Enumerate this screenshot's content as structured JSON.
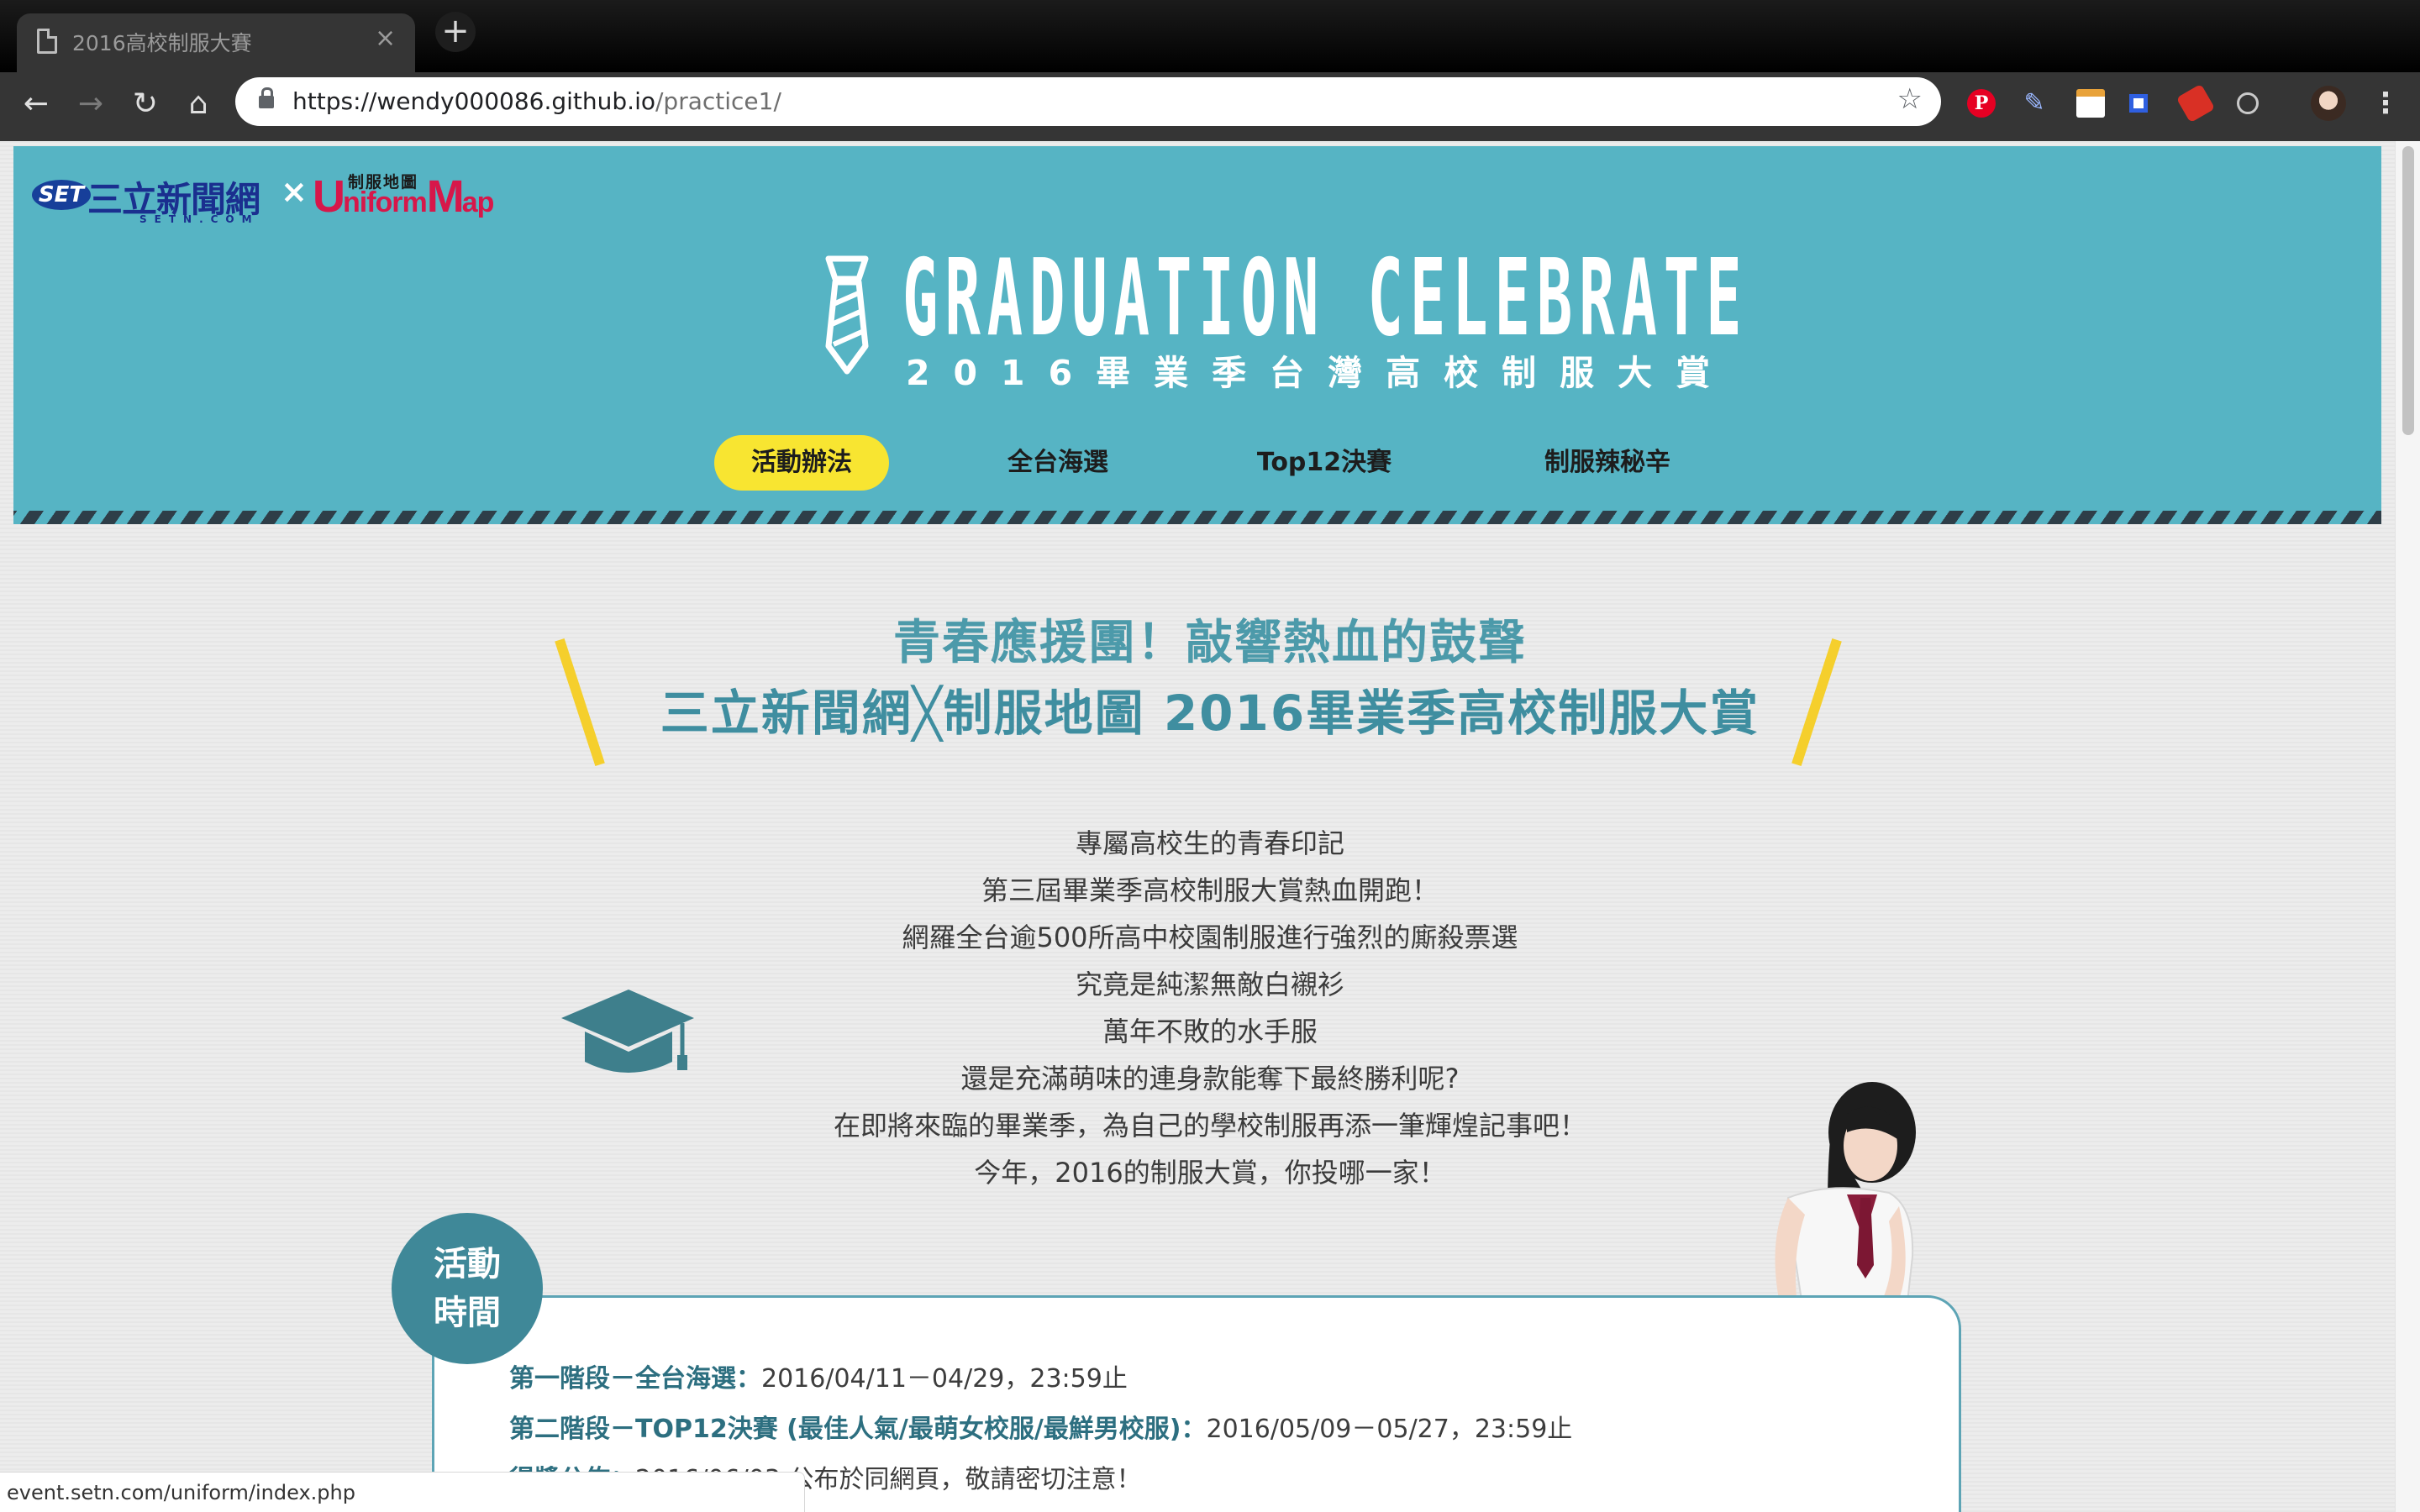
{
  "browser": {
    "tab_title": "2016高校制服大賽",
    "tab_close": "×",
    "new_tab": "+",
    "url_host": "https://wendy000086.github.io",
    "url_path": "/practice1/",
    "status_url": "event.setn.com/uniform/index.php",
    "buttons": {
      "back": "←",
      "forward": "→",
      "reload": "↻",
      "home": "⌂",
      "star": "☆",
      "menu": "⋮"
    },
    "extensions": [
      "pinterest-icon",
      "pen-icon",
      "calendar-icon",
      "square-icon",
      "red-extension-icon",
      "circle-icon"
    ],
    "pinterest_glyph": "P",
    "pen_glyph": "✎"
  },
  "header": {
    "logo_setn": {
      "mark": "SET",
      "name": "三立新聞網",
      "domain": "SETN.COM"
    },
    "logo_separator": "×",
    "logo_uniformmap": {
      "top": "制服地圖",
      "main_u": "U",
      "main_iform": "niform",
      "main_m": "M",
      "main_ap": "ap"
    },
    "title": "GRADUATION CELEBRATE",
    "subtitle": "2016畢業季台灣高校制服大賞",
    "nav": [
      {
        "label": "活動辦法",
        "active": true
      },
      {
        "label": "全台海選",
        "active": false
      },
      {
        "label": "Top12決賽",
        "active": false
      },
      {
        "label": "制服辣秘辛",
        "active": false
      }
    ]
  },
  "headline": {
    "line1": "青春應援團！敲響熱血的鼓聲",
    "line2": "三立新聞網╳制服地圖 2016畢業季高校制服大賞"
  },
  "intro": [
    "專屬高校生的青春印記",
    "第三屆畢業季高校制服大賞熱血開跑！",
    "網羅全台逾500所高中校園制服進行強烈的廝殺票選",
    "究竟是純潔無敵白襯衫",
    "萬年不敗的水手服",
    "還是充滿萌味的連身款能奪下最終勝利呢?",
    "在即將來臨的畢業季，為自己的學校制服再添一筆輝煌記事吧！",
    "今年，2016的制服大賞，你投哪一家！"
  ],
  "schedule": {
    "badge": [
      "活動",
      "時間"
    ],
    "rows": [
      {
        "label": "第一階段－全台海選：",
        "value": "2016/04/11－04/29，23:59止"
      },
      {
        "label": "第二階段－TOP12決賽 (最佳人氣/最萌女校服/最鮮男校服)：",
        "value": "2016/05/09－05/27，23:59止"
      },
      {
        "label": "得獎公佈：",
        "value": "2016/06/03 公布於同網頁，敬請密切注意！"
      }
    ]
  },
  "colors": {
    "header_bg": "#56b4c4",
    "nav_active": "#f8e531",
    "headline": "#4c9aaa",
    "accent_yellow": "#f5cf2c",
    "badge": "#3f8898",
    "brand_red": "#d7174a",
    "brand_blue": "#1a2f8f"
  }
}
